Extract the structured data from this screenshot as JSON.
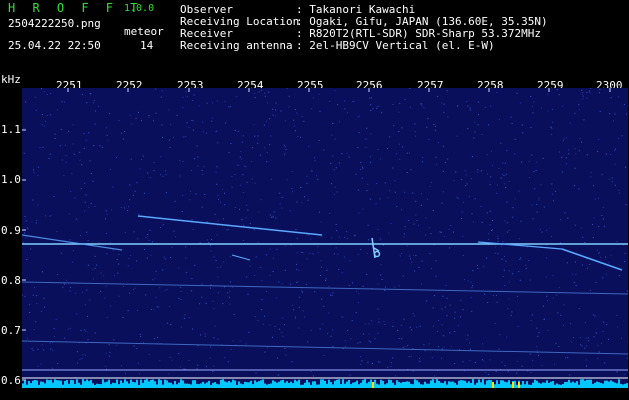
{
  "header": {
    "app_title": "H R O F F T",
    "app_version": "1.0.0",
    "filename": "2504222250.png",
    "meteor_label": "meteor",
    "datetime": "25.04.22 22:50",
    "meteor_count": "14"
  },
  "info": [
    {
      "label": "Observer",
      "value": ": Takanori Kawachi"
    },
    {
      "label": "Receiving Location",
      "value": ": Ogaki, Gifu, JAPAN (136.60E, 35.35N)"
    },
    {
      "label": "Receiver",
      "value": ": R820T2(RTL-SDR) SDR-Sharp 53.372MHz"
    },
    {
      "label": "Receiving antenna",
      "value": ": 2el-HB9CV Vertical (el. E-W)"
    }
  ],
  "axes": {
    "freq_unit": "kHz",
    "time_ticks": [
      "2251",
      "2252",
      "2253",
      "2254",
      "2255",
      "2256",
      "2257",
      "2258",
      "2259",
      "2300"
    ],
    "freq_ticks": [
      "1.1",
      "1.0",
      "0.9",
      "0.8",
      "0.7",
      "0.6"
    ]
  },
  "colors": {
    "background": "#000000",
    "spectrogram_bg": "#0a0f5c",
    "signal": "#5aa8ff",
    "carrier": "#7fd0ff",
    "noise_floor": "#00c8ff",
    "header_green": "#2fe02f"
  }
}
